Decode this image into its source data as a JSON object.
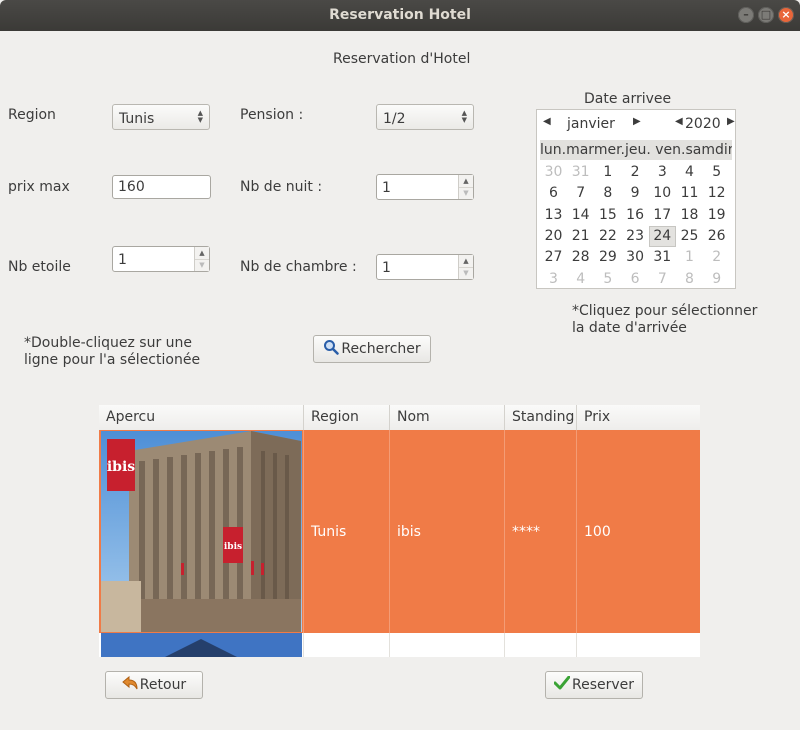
{
  "window": {
    "title": "Reservation Hotel"
  },
  "form": {
    "heading": "Reservation d'Hotel",
    "region": {
      "label": "Region",
      "value": "Tunis"
    },
    "prix_max": {
      "label": "prix max",
      "value": "160"
    },
    "nb_etoile": {
      "label": "Nb etoile",
      "value": "1"
    },
    "pension": {
      "label": "Pension :",
      "value": "1/2"
    },
    "nb_nuit": {
      "label": "Nb de nuit :",
      "value": "1"
    },
    "nb_chambre": {
      "label": "Nb de chambre :",
      "value": "1"
    },
    "hint_double_click": [
      "*Double-cliquez sur une",
      "ligne pour l'a sélectionée"
    ],
    "search_button": "Rechercher"
  },
  "calendar": {
    "label": "Date arrivee",
    "month": "janvier",
    "year": "2020",
    "dows": "lun.marmer.jeu. ven.samdim.",
    "weeks": [
      [
        {
          "d": "30",
          "o": true
        },
        {
          "d": "31",
          "o": true
        },
        {
          "d": "1"
        },
        {
          "d": "2"
        },
        {
          "d": "3"
        },
        {
          "d": "4"
        },
        {
          "d": "5"
        }
      ],
      [
        {
          "d": "6"
        },
        {
          "d": "7"
        },
        {
          "d": "8"
        },
        {
          "d": "9"
        },
        {
          "d": "10"
        },
        {
          "d": "11"
        },
        {
          "d": "12"
        }
      ],
      [
        {
          "d": "13"
        },
        {
          "d": "14"
        },
        {
          "d": "15"
        },
        {
          "d": "16"
        },
        {
          "d": "17"
        },
        {
          "d": "18"
        },
        {
          "d": "19"
        }
      ],
      [
        {
          "d": "20"
        },
        {
          "d": "21"
        },
        {
          "d": "22"
        },
        {
          "d": "23"
        },
        {
          "d": "24",
          "s": true
        },
        {
          "d": "25"
        },
        {
          "d": "26"
        }
      ],
      [
        {
          "d": "27"
        },
        {
          "d": "28"
        },
        {
          "d": "29"
        },
        {
          "d": "30"
        },
        {
          "d": "31"
        },
        {
          "d": "1",
          "o": true
        },
        {
          "d": "2",
          "o": true
        }
      ],
      [
        {
          "d": "3",
          "o": true
        },
        {
          "d": "4",
          "o": true
        },
        {
          "d": "5",
          "o": true
        },
        {
          "d": "6",
          "o": true
        },
        {
          "d": "7",
          "o": true
        },
        {
          "d": "8",
          "o": true
        },
        {
          "d": "9",
          "o": true
        }
      ]
    ],
    "hint": [
      "*Cliquez pour sélectionner",
      "la date d'arrivée"
    ]
  },
  "table": {
    "headers": [
      "Apercu",
      "Region",
      "Nom",
      "Standing",
      "Prix"
    ],
    "rows": [
      {
        "region": "Tunis",
        "nom": "ibis",
        "standing": "****",
        "prix": "100",
        "selected": true
      }
    ],
    "logo_text": "ibis"
  },
  "footer": {
    "back_button": "Retour",
    "reserve_button": "Reserver"
  },
  "colors": {
    "selection": "#f07b47",
    "titlebar": "#3e3d39",
    "close": "#e9663a"
  }
}
